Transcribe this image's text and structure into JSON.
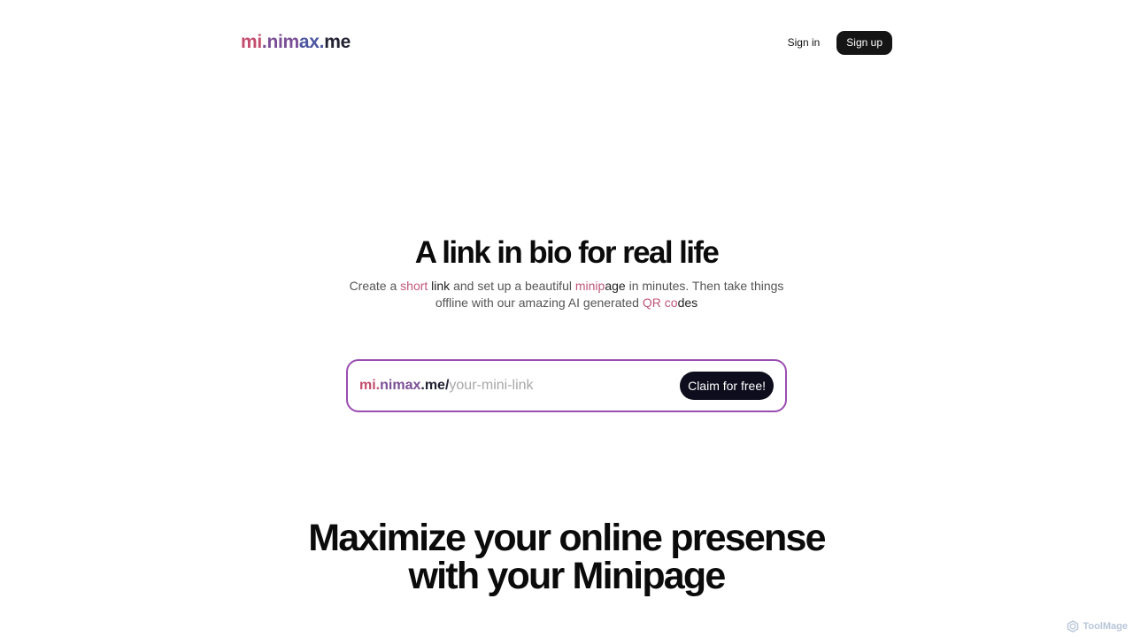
{
  "header": {
    "logo": [
      "mi",
      ".nim",
      "ax.",
      "me"
    ],
    "signin_label": "Sign in",
    "signup_label": "Sign up"
  },
  "hero": {
    "title": "A link in bio for real life",
    "subtitle": [
      "Create a ",
      "short",
      " link",
      " and set up a beautiful ",
      "minip",
      "age",
      " in minutes. Then take things offline with our amazing AI generated ",
      "QR",
      " co",
      "des"
    ]
  },
  "claim": {
    "prefix": [
      "mi.",
      "nimax",
      ".me",
      "/"
    ],
    "placeholder": "your-mini-link",
    "button_label": "Claim for free!"
  },
  "section": {
    "title_line1": "Maximize your online presense",
    "title_line2": "with your Minipage"
  },
  "watermark": {
    "label": "ToolMage"
  },
  "colors": {
    "brand_pink": "#c44d6e",
    "brand_purple": "#7b4f96",
    "brand_blue": "#4c56a0",
    "claim_border": "#9a4db0",
    "button_dark": "#151515"
  }
}
